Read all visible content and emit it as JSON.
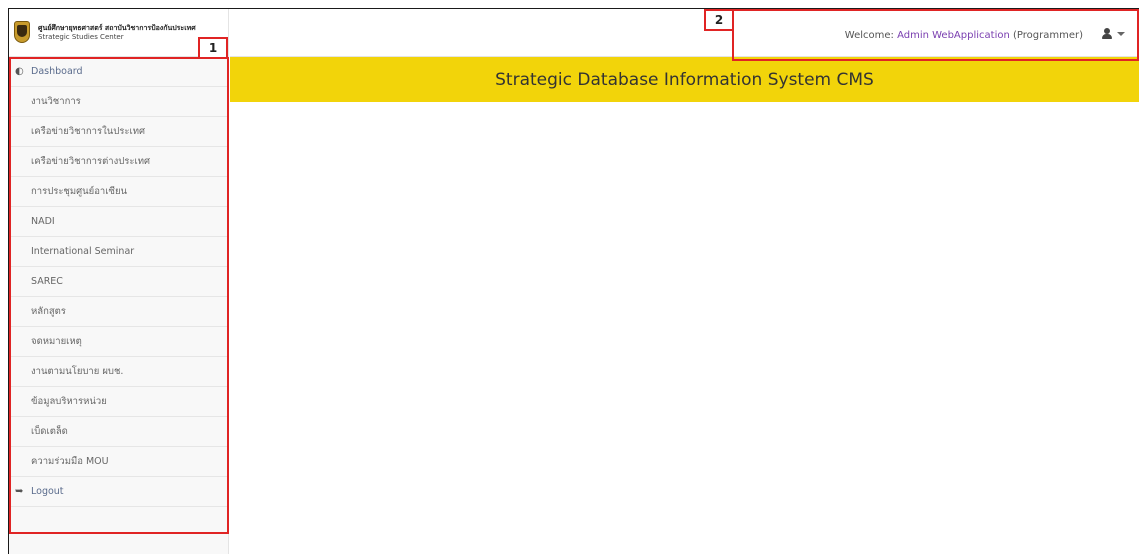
{
  "brand": {
    "line_th": "ศูนย์ศึกษายุทธศาสตร์ สถาบันวิชาการป้องกันประเทศ",
    "line_en": "Strategic Studies Center"
  },
  "header": {
    "welcome_prefix": "Welcome:",
    "user_name": "Admin WebApplication",
    "user_role": "(Programmer)"
  },
  "banner": {
    "title": "Strategic Database Information System CMS"
  },
  "sidebar": {
    "dashboard": "Dashboard",
    "items": [
      "งานวิชาการ",
      "เครือข่ายวิชาการในประเทศ",
      "เครือข่ายวิชาการต่างประเทศ",
      "การประชุมศูนย์อาเซียน",
      "NADI",
      "International Seminar",
      "SAREC",
      "หลักสูตร",
      "จดหมายเหตุ",
      "งานตามนโยบาย ผบช.",
      "ข้อมูลบริหารหน่วย",
      "เบ็ดเตล็ด",
      "ความร่วมมือ MOU"
    ],
    "logout": "Logout"
  },
  "annotations": {
    "label_1": "1",
    "label_2": "2",
    "color": "#e02424"
  },
  "colors": {
    "banner": "#f2d40a",
    "user_name": "#7a3fb0"
  }
}
